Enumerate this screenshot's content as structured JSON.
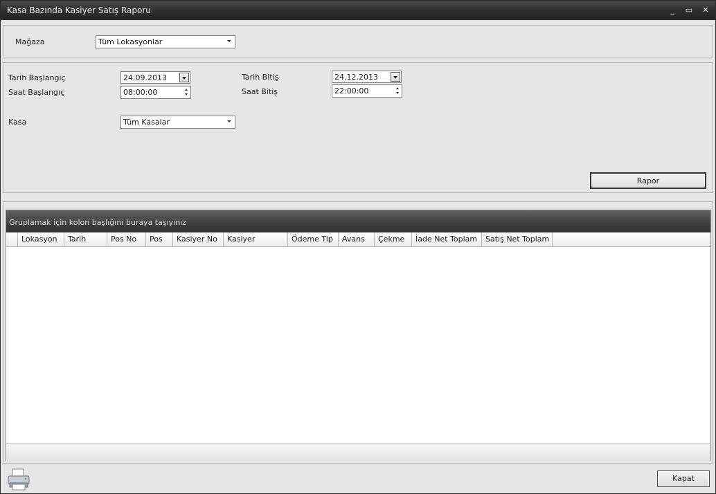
{
  "window": {
    "title": "Kasa Bazında Kasiyer Satış Raporu",
    "minimize": "_",
    "maximize": "▭",
    "close": "✕"
  },
  "store": {
    "label": "Mağaza",
    "value": "Tüm Lokasyonlar"
  },
  "filters": {
    "start_date_label": "Tarih Başlangıç",
    "start_date": "24.09.2013",
    "start_time_label": "Saat Başlangıç",
    "start_time": "08:00:00",
    "end_date_label": "Tarih Bitiş",
    "end_date": "24.12.2013",
    "end_time_label": "Saat Bitiş",
    "end_time": "22:00:00",
    "register_label": "Kasa",
    "register_value": "Tüm Kasalar",
    "report_button": "Rapor"
  },
  "grid": {
    "group_hint": "Gruplamak için kolon başlığını buraya taşıyınız",
    "columns": [
      "Lokasyon",
      "Tarih",
      "Pos No",
      "Pos",
      "Kasiyer No",
      "Kasiyer",
      "Ödeme Tip",
      "Avans",
      "Çekme",
      "İade Net Toplam",
      "Satış Net Toplam"
    ]
  },
  "footer": {
    "print_icon": "printer-icon",
    "close_button": "Kapat"
  }
}
